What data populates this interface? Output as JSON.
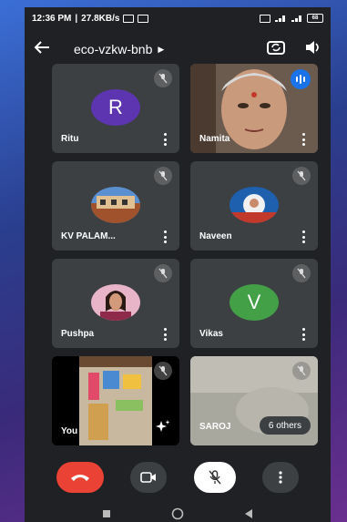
{
  "status": {
    "time": "12:36 PM",
    "speed": "27.8KB/s",
    "battery": "68"
  },
  "meeting": {
    "code": "eco-vzkw-bnb"
  },
  "participants": [
    {
      "name": "Ritu",
      "initial": "R"
    },
    {
      "name": "Namita"
    },
    {
      "name": "KV PALAM..."
    },
    {
      "name": "Naveen"
    },
    {
      "name": "Pushpa"
    },
    {
      "name": "Vikas",
      "initial": "V"
    },
    {
      "name": "You"
    },
    {
      "name": "SAROJ"
    }
  ],
  "others_label": "6 others",
  "colors": {
    "end_call": "#ea4335",
    "ritu_avatar": "#5e35b1",
    "vikas_avatar": "#43a047",
    "speaking": "#1a73e8",
    "tile": "#3c4043",
    "background": "#202124"
  },
  "icons": [
    "back-arrow-icon",
    "switch-camera-icon",
    "speaker-icon",
    "mic-off-icon",
    "more-vert-icon",
    "speaking-icon",
    "effects-icon",
    "end-call-icon",
    "camera-icon"
  ]
}
